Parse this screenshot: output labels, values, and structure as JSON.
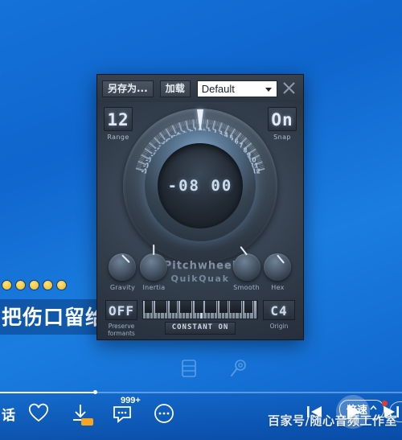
{
  "player": {
    "lyric_line": "把伤口留给",
    "left_partial_text": "话",
    "comment_count": "999+",
    "watermark": "百家号/随心音频工作室",
    "speed_label": "倍速",
    "icons": {
      "favorite": "heart-icon",
      "download": "download-icon",
      "comment": "comment-icon",
      "more": "more-dots-icon",
      "previous": "previous-track-icon",
      "play": "play-icon",
      "next": "next-track-icon",
      "playlist": "playlist-icon",
      "microphone": "microphone-icon"
    }
  },
  "plugin": {
    "titlebar": {
      "save_as_label": "另存为...",
      "load_label": "加载",
      "preset_value": "Default",
      "close_label": "close-icon"
    },
    "range": {
      "value": "12",
      "label": "Range"
    },
    "snap": {
      "value": "On",
      "label": "Snap"
    },
    "readout": "-08 00",
    "dial": {
      "tick_numbers": [
        "-12",
        "-11",
        "-10",
        "-9",
        "-8",
        "-7",
        "-6",
        "-5",
        "-4",
        "-3",
        "-2",
        "-1",
        "0",
        "+1",
        "+2",
        "+3",
        "+4",
        "+5",
        "+6",
        "+7",
        "+8",
        "+9",
        "+10",
        "+11",
        "+12"
      ],
      "needle_value": 0,
      "min": -12,
      "max": 12
    },
    "brand": {
      "product": "Pitchwheel",
      "company": "QuikQuak"
    },
    "knobs": [
      {
        "label": "Gravity",
        "angle": 135
      },
      {
        "label": "Inertia",
        "angle": 0
      },
      {
        "label": "Smooth",
        "angle": -38
      },
      {
        "label": "Hex",
        "angle": 140
      }
    ],
    "preserve_formants": {
      "value": "OFF",
      "label_line1": "Preserve",
      "label_line2": "formants"
    },
    "constant_button": "CONSTANT ON",
    "origin": {
      "value": "C4",
      "label": "Origin"
    }
  },
  "colors": {
    "desktop_blue": "#1472d8",
    "panel_dark": "#2b3542",
    "led_text": "#cfdcea",
    "accent_orange": "#f5a623",
    "badge_red": "#e8372b"
  }
}
